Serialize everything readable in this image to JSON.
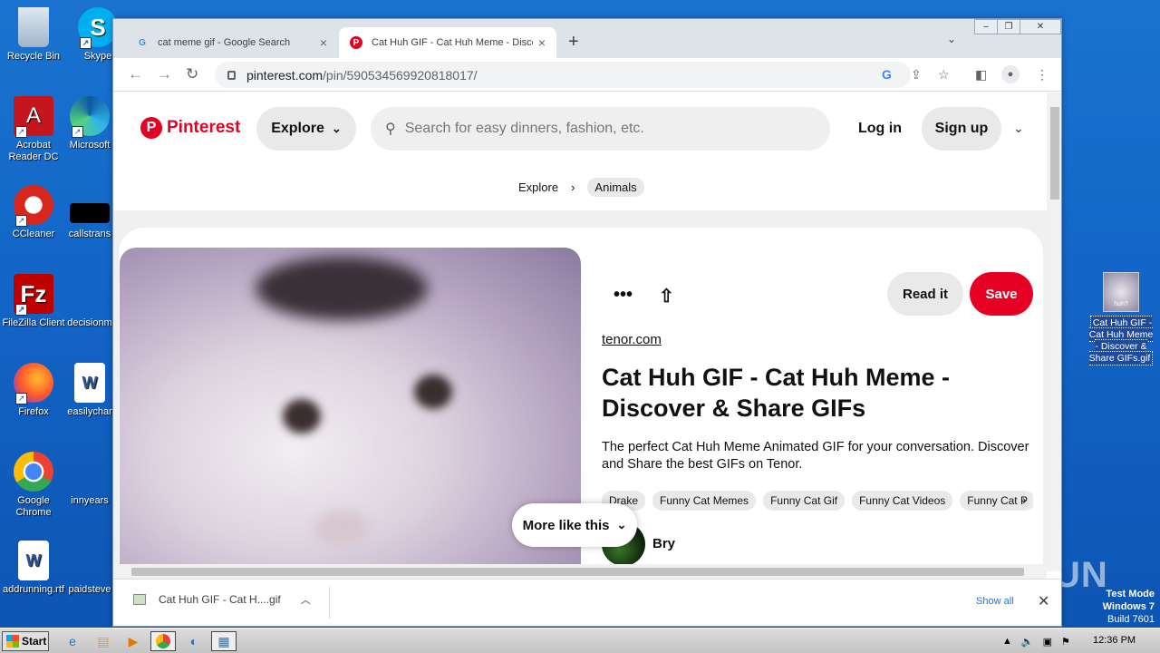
{
  "desktop": {
    "icons": [
      {
        "label": "Recycle Bin",
        "icon": "recycle-bin-icon"
      },
      {
        "label": "Skype",
        "icon": "skype-icon"
      },
      {
        "label": "Acrobat Reader DC",
        "icon": "acrobat-icon"
      },
      {
        "label": "Microsoft",
        "icon": "edge-icon"
      },
      {
        "label": "CCleaner",
        "icon": "ccleaner-icon"
      },
      {
        "label": "callstrans",
        "icon": "file-icon"
      },
      {
        "label": "FileZilla Client",
        "icon": "filezilla-icon"
      },
      {
        "label": "decisionm",
        "icon": "file-icon"
      },
      {
        "label": "Firefox",
        "icon": "firefox-icon"
      },
      {
        "label": "easilychar",
        "icon": "word-doc-icon"
      },
      {
        "label": "Google Chrome",
        "icon": "chrome-icon"
      },
      {
        "label": "innyears",
        "icon": "file-icon"
      },
      {
        "label": "addrunning.rtf",
        "icon": "word-doc-icon"
      },
      {
        "label": "paidsteve",
        "icon": "file-icon"
      }
    ],
    "right_file": {
      "label": "Cat Huh GIF - Cat Huh Meme - Discover & Share GIFs.gif",
      "thumb_text": "huh?"
    },
    "watermark": "ANY.RUN",
    "test_mode": {
      "line1": "Test Mode",
      "line2": "Windows 7",
      "line3": "Build 7601"
    }
  },
  "browser": {
    "tabs": [
      {
        "title": "cat meme gif - Google Search",
        "active": false
      },
      {
        "title": "Cat Huh GIF - Cat Huh Meme - Disco",
        "active": true
      }
    ],
    "url_host": "pinterest.com",
    "url_path": "/pin/590534569920818017/",
    "download": {
      "filename": "Cat Huh GIF - Cat H....gif",
      "show_all": "Show all"
    }
  },
  "pinterest": {
    "logo_text": "Pinterest",
    "explore_label": "Explore",
    "search_placeholder": "Search for easy dinners, fashion, etc.",
    "login_label": "Log in",
    "signup_label": "Sign up",
    "breadcrumb": {
      "root": "Explore",
      "current": "Animals"
    },
    "pin": {
      "read_it_label": "Read it",
      "save_label": "Save",
      "source": "tenor.com",
      "title": "Cat Huh GIF - Cat Huh Meme - Discover & Share GIFs",
      "description": "The perfect Cat Huh Meme Animated GIF for your conversation. Discover and Share the best GIFs on Tenor.",
      "tags": [
        "Drake",
        "Funny Cat Memes",
        "Funny Cat Gif",
        "Funny Cat Videos",
        "Funny Cat P"
      ],
      "author": "Bry",
      "more_like_this": "More like this"
    }
  },
  "taskbar": {
    "start_label": "Start",
    "clock": "12:36 PM"
  },
  "colors": {
    "pinterest_red": "#e60023",
    "desktop_blue": "#1565c8"
  }
}
